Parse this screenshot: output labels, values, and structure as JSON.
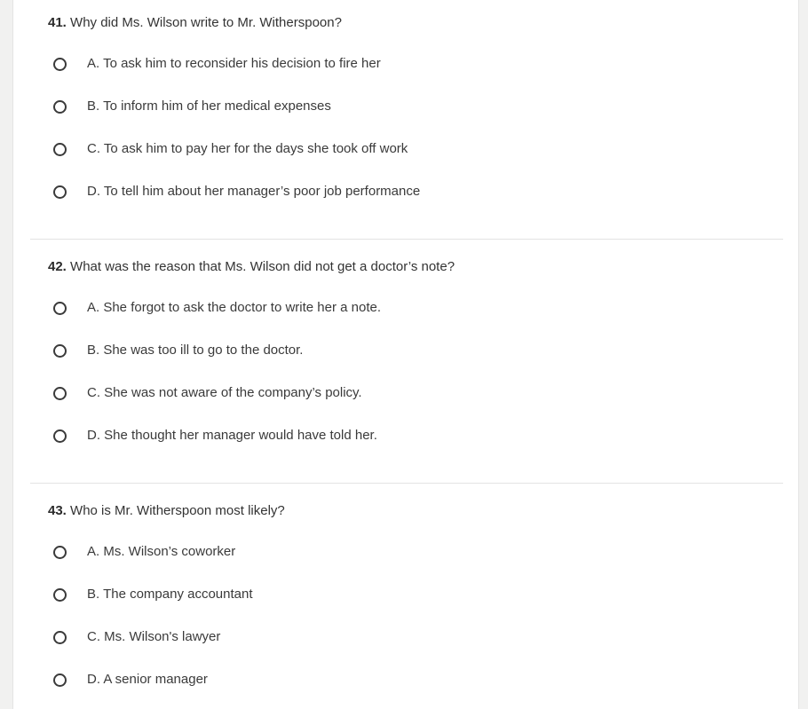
{
  "questions": [
    {
      "number": "41.",
      "text": "Why did Ms. Wilson write to Mr. Witherspoon?",
      "options": [
        "A. To ask him to reconsider his decision to fire her",
        "B. To inform him of her medical expenses",
        "C. To ask him to pay her for the days she took off work",
        "D. To tell him about her manager’s poor job performance"
      ]
    },
    {
      "number": "42.",
      "text": "What was the reason that Ms. Wilson did not get a doctor’s note?",
      "options": [
        "A. She forgot to ask the doctor to write her a note.",
        "B. She was too ill to go to the doctor.",
        "C. She was not aware of the company’s policy.",
        "D. She thought her manager would have told her."
      ]
    },
    {
      "number": "43.",
      "text": "Who is Mr. Witherspoon most likely?",
      "options": [
        "A. Ms. Wilson’s coworker",
        "B. The company accountant",
        "C. Ms. Wilson's lawyer",
        "D. A senior manager"
      ]
    }
  ]
}
